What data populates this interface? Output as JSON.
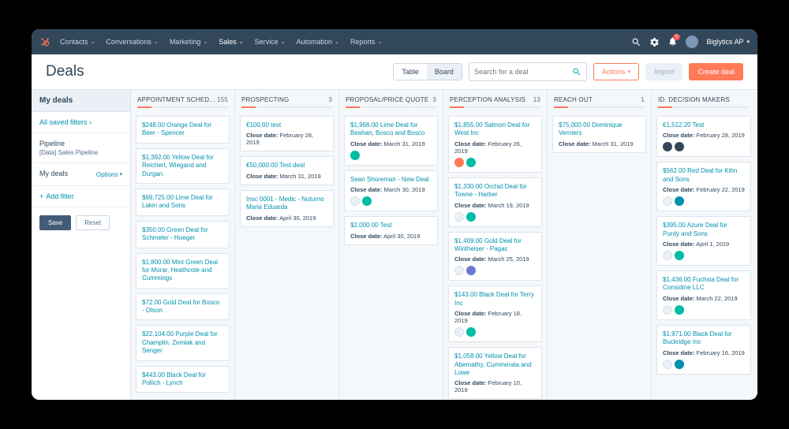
{
  "nav": {
    "items": [
      "Contacts",
      "Conversations",
      "Marketing",
      "Sales",
      "Service",
      "Automation",
      "Reports"
    ],
    "active_index": 3,
    "notifications": "0",
    "account": "Biglytics AP"
  },
  "page": {
    "title": "Deals",
    "view_table": "Table",
    "view_board": "Board",
    "search_placeholder": "Search for a deal",
    "actions": "Actions",
    "import": "Import",
    "create": "Create deal"
  },
  "sidebar": {
    "header": "My deals",
    "saved_filters": "All saved filters",
    "pipeline_label": "Pipeline",
    "pipeline_value": "[Data] Sales Pipeline",
    "mydeals": "My deals",
    "options": "Options",
    "add_filter": "Add filter",
    "save": "Save",
    "reset": "Reset"
  },
  "columns": [
    {
      "name": "APPOINTMENT SCHEDULED",
      "count": "155",
      "cards": [
        {
          "title": "$248.00 Orange Deal for Beer - Spencer"
        },
        {
          "title": "$1,392.00 Yellow Deal for Reichert, Wiegand and Durgan"
        },
        {
          "title": "$69,725.00 Lime Deal for Lakin and Sons"
        },
        {
          "title": "$350.00 Green Deal for Schmeler - Hoeger"
        },
        {
          "title": "$1,800.00 Mint Green Deal for Morar, Heathcote and Cummings"
        },
        {
          "title": "$72.00 Gold Deal for Bosco - Olson"
        },
        {
          "title": "$22,104.00 Purple Deal for Champlin, Zemlak and Senger"
        },
        {
          "title": "$443.00 Black Deal for Pollich - Lynch"
        }
      ]
    },
    {
      "name": "PROSPECTING",
      "count": "3",
      "cards": [
        {
          "title": "€100,00 test",
          "close": "February 28, 2019"
        },
        {
          "title": "€50,000.00 Test deal",
          "close": "March 31, 2019"
        },
        {
          "title": "Insc 0001 - Medic - Noturno Maria Eduarda",
          "close": "April 30, 2019"
        }
      ]
    },
    {
      "name": "PROPOSAL/PRICE QUOTE",
      "count": "3",
      "cards": [
        {
          "title": "$1,966.00 Lime Deal for Beahan, Bosco and Bosco",
          "close": "March 31, 2019",
          "avatars": [
            "teal"
          ]
        },
        {
          "title": "Sean Shoreman - New Deal",
          "close": "March 30, 2019",
          "avatars": [
            "blank",
            "teal"
          ]
        },
        {
          "title": "$2,000.00 Test",
          "close": "April 30, 2019"
        }
      ]
    },
    {
      "name": "PERCEPTION ANALYSIS",
      "count": "13",
      "cards": [
        {
          "title": "$1,855.00 Salmon Deal for West Inc",
          "close": "February 26, 2019",
          "avatars": [
            "orange",
            "teal"
          ]
        },
        {
          "title": "$1,330.00 Orchid Deal for Towne - Harber",
          "close": "March 19, 2019",
          "avatars": [
            "blank",
            "teal"
          ]
        },
        {
          "title": "$1,409.00 Gold Deal for Wintheiser - Pagac",
          "close": "March 25, 2019",
          "avatars": [
            "blank",
            "purple"
          ]
        },
        {
          "title": "$143.00 Black Deal for Terry Inc",
          "close": "February 18, 2019",
          "avatars": [
            "blank",
            "teal"
          ]
        },
        {
          "title": "$1,058.00 Yellow Deal for Abernathy, Cummerata and Lowe",
          "close": "February 10, 2019"
        }
      ]
    },
    {
      "name": "REACH OUT",
      "count": "1",
      "cards": [
        {
          "title": "$75,000.00 Dominique Verniers",
          "close": "March 31, 2019"
        }
      ]
    },
    {
      "name": "ID. DECISION MAKERS",
      "count": "",
      "cards": [
        {
          "title": "€1,512.20 Test",
          "close": "February 28, 2019",
          "avatars": [
            "dark",
            "dark"
          ]
        },
        {
          "title": "$562.00 Red Deal for Kihn and Sons",
          "close": "February 22, 2019",
          "avatars": [
            "blank",
            "blue"
          ]
        },
        {
          "title": "$395.00 Azure Deal for Purdy and Sons",
          "close": "April 1, 2019",
          "avatars": [
            "blank",
            "teal"
          ]
        },
        {
          "title": "$1,436.00 Fuchsia Deal for Considine LLC",
          "close": "March 22, 2019",
          "avatars": [
            "blank",
            "teal"
          ]
        },
        {
          "title": "$1,971.00 Black Deal for Buckridge Inc",
          "close": "February 16, 2019",
          "avatars": [
            "blank",
            "blue"
          ]
        }
      ]
    }
  ],
  "close_label": "Close date:"
}
